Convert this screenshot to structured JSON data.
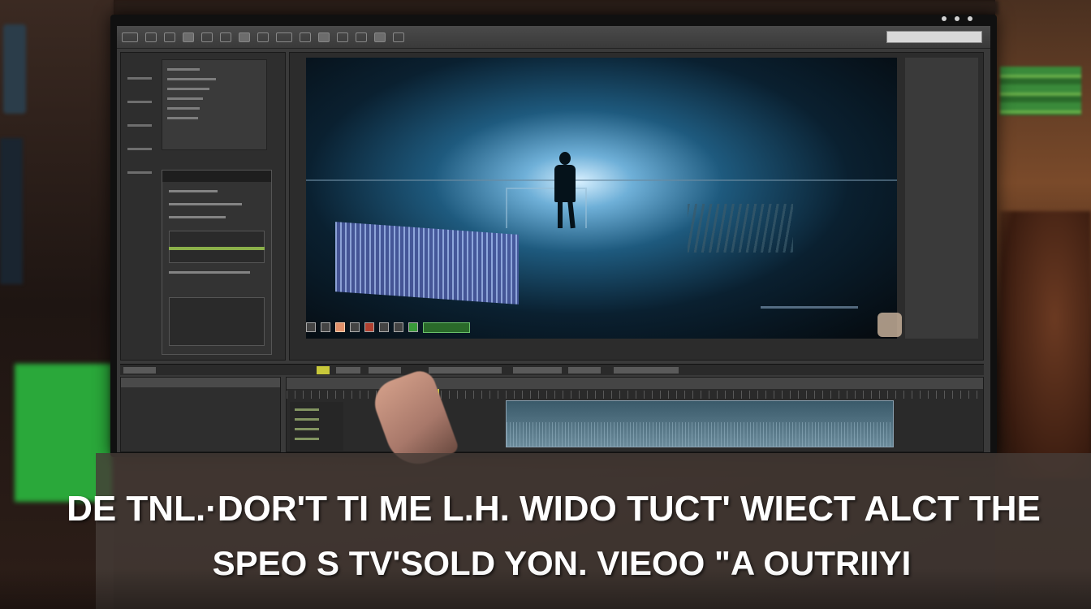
{
  "caption": {
    "line1": "DE TNL.·DOR'T TI ME L.H. WIDO TUCT' WIECT ALCT THE",
    "line2": "SPEO S TV'SOLD YON. VIEOO \"A OUTRIIYI"
  },
  "editor": {
    "toolbar_icons": [
      "logo-icon",
      "undo-icon",
      "redo-icon",
      "cut-icon",
      "copy-icon",
      "paste-icon",
      "select-icon",
      "blade-icon",
      "zoom-icon",
      "hand-icon",
      "snap-icon",
      "link-icon",
      "marker-icon",
      "render-icon",
      "settings-icon"
    ],
    "accent_green": "#3a9a3a",
    "playhead_color": "#c8c83a"
  }
}
